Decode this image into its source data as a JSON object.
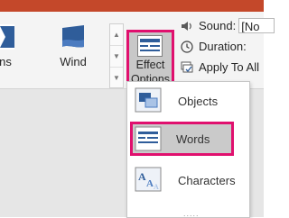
{
  "colors": {
    "title_bar": "#c4482a",
    "highlight_border": "#e0106e",
    "selected_fill": "#c8c8c8",
    "icon_blue": "#2f5d9a",
    "icon_light_blue": "#a9c3e6"
  },
  "ribbon": {
    "gallery": [
      {
        "label": "ains",
        "icon": "shape-effect-icon"
      },
      {
        "label": "Wind",
        "icon": "wind-effect-icon"
      }
    ],
    "scroll": {
      "up": "▲",
      "down": "▼",
      "more": "▼"
    },
    "effect_options": {
      "line1": "Effect",
      "line2": "Options",
      "caret": "▾",
      "icon": "effect-options-icon"
    }
  },
  "timing": {
    "sound_label": "Sound:",
    "sound_value": "[No",
    "duration_label": "Duration:",
    "apply_label": "Apply To All"
  },
  "menu": {
    "items": [
      {
        "label": "Objects",
        "icon": "objects-icon",
        "selected": false
      },
      {
        "label": "Words",
        "icon": "words-icon",
        "selected": true
      },
      {
        "label": "Characters",
        "icon": "characters-icon",
        "selected": false
      }
    ],
    "grip": "....."
  }
}
